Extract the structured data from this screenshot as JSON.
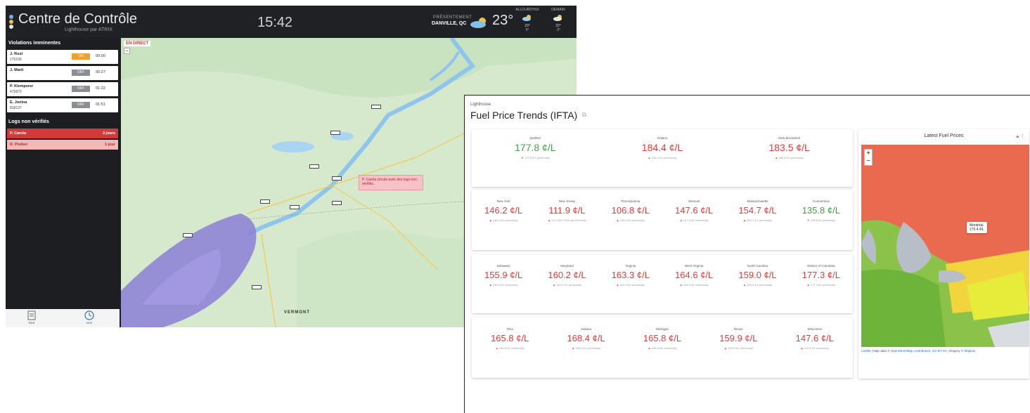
{
  "control_center": {
    "title": "Centre de Contrôle",
    "subtitle": "Lighthouse par ATRIX",
    "clock": "15:42",
    "weather": {
      "now_label": "PRÉSENTEMENT",
      "city": "DANVILLE, QC",
      "temp": "23°",
      "forecast": [
        {
          "label": "ALLOURD'HUI",
          "hi": "23°",
          "lo": "5°"
        },
        {
          "label": "DEMAIN",
          "hi": "22°",
          "lo": "-2°"
        }
      ]
    },
    "violations_title": "Violations imminentes",
    "violations": [
      {
        "name": "J. Rust",
        "id": "170109",
        "status": "ON",
        "time": "00:00",
        "state": "on"
      },
      {
        "name": "J. Marti",
        "id": "",
        "status": "OFF",
        "time": "00:27",
        "state": "off"
      },
      {
        "name": "P. Klemperer",
        "id": "475873",
        "status": "OFF",
        "time": "01:22",
        "state": "off"
      },
      {
        "name": "E. Jonina",
        "id": "818137",
        "status": "OFF",
        "time": "01:51",
        "state": "off"
      }
    ],
    "logs_title": "Logs non vérifiés",
    "logs": [
      {
        "name": "P. Carola",
        "time": "3 jours",
        "style": "red"
      },
      {
        "name": "D. Pistker",
        "time": "1 jour",
        "style": "pink"
      }
    ],
    "bottom_tabs": [
      "RDS",
      "HOS"
    ],
    "map": {
      "live_label": "EN DIRECT",
      "tooltip": "P. Carola circule avec des logs non vérifiés.",
      "region_label": "VERMONT"
    }
  },
  "lighthouse": {
    "brand": "Lighthouse",
    "title": "Fuel Price Trends (IFTA)",
    "rows": [
      [
        {
          "state": "Québec",
          "price": "177.8 ¢/L",
          "trend": "down",
          "prev": "177.8 ¢/L previously"
        },
        {
          "state": "Ontario",
          "price": "184.4 ¢/L",
          "trend": "up",
          "prev": "184.4 ¢/L previously"
        },
        {
          "state": "New Brunswick",
          "price": "183.5 ¢/L",
          "trend": "up",
          "prev": "183.5 ¢/L previously"
        }
      ],
      [
        {
          "state": "New York",
          "price": "146.2 ¢/L",
          "trend": "up",
          "prev": "146.2 ¢/L previously"
        },
        {
          "state": "New Jersey",
          "price": "111.9 ¢/L",
          "trend": "up",
          "prev": "111.9 ¢/L Price per Previous"
        },
        {
          "state": "Pennsylvania",
          "price": "106.8 ¢/L",
          "trend": "up",
          "prev": "106.8 ¢/L previously"
        },
        {
          "state": "Vermont",
          "price": "147.6 ¢/L",
          "trend": "up",
          "prev": "147.6 ¢/L previously"
        },
        {
          "state": "Massachusetts",
          "price": "154.7 ¢/L",
          "trend": "up",
          "prev": "154.7 ¢/L previously"
        },
        {
          "state": "Connecticut",
          "price": "135.8 ¢/L",
          "trend": "down",
          "prev": "135.8 ¢/L previously"
        }
      ],
      [
        {
          "state": "Delaware",
          "price": "155.9 ¢/L",
          "trend": "up",
          "prev": "155.9 ¢/L previously"
        },
        {
          "state": "Maryland",
          "price": "160.2 ¢/L",
          "trend": "up",
          "prev": "160.2 ¢/L previously"
        },
        {
          "state": "Virginia",
          "price": "163.3 ¢/L",
          "trend": "up",
          "prev": "163.3 ¢/L previously"
        },
        {
          "state": "West Virginia",
          "price": "164.6 ¢/L",
          "trend": "up",
          "prev": "164.6 ¢/L previously"
        },
        {
          "state": "North Carolina",
          "price": "159.0 ¢/L",
          "trend": "up",
          "prev": "159.0 ¢/L previously"
        },
        {
          "state": "District of Columbia",
          "price": "177.3 ¢/L",
          "trend": "up",
          "prev": "177.3 ¢/L previously"
        }
      ],
      [
        {
          "state": "Ohio",
          "price": "165.8 ¢/L",
          "trend": "up",
          "prev": "165.8 ¢/L previously"
        },
        {
          "state": "Indiana",
          "price": "168.4 ¢/L",
          "trend": "up",
          "prev": "168.4 ¢/L previously"
        },
        {
          "state": "Michigan",
          "price": "165.8 ¢/L",
          "trend": "up",
          "prev": "165.8 ¢/L previously"
        },
        {
          "state": "Illinois",
          "price": "159.9 ¢/L",
          "trend": "up",
          "prev": "159.9 ¢/L previously"
        },
        {
          "state": "Wisconsin",
          "price": "147.6 ¢/L",
          "trend": "up",
          "prev": "147.6 ¢/L previously"
        }
      ]
    ],
    "map_panel": {
      "title": "Latest Fuel Prices",
      "tooltip_city": "Montréal",
      "tooltip_price": "175.4 ¢/L",
      "attr_leaflet": "Leaflet",
      "attr_text1": " | Map data © ",
      "attr_osm": "OpenStreetMap contributors",
      "attr_text2": ", ",
      "attr_cc": "CC-BY-SA",
      "attr_text3": ", Imagery © ",
      "attr_mapbox": "Mapbox"
    }
  }
}
